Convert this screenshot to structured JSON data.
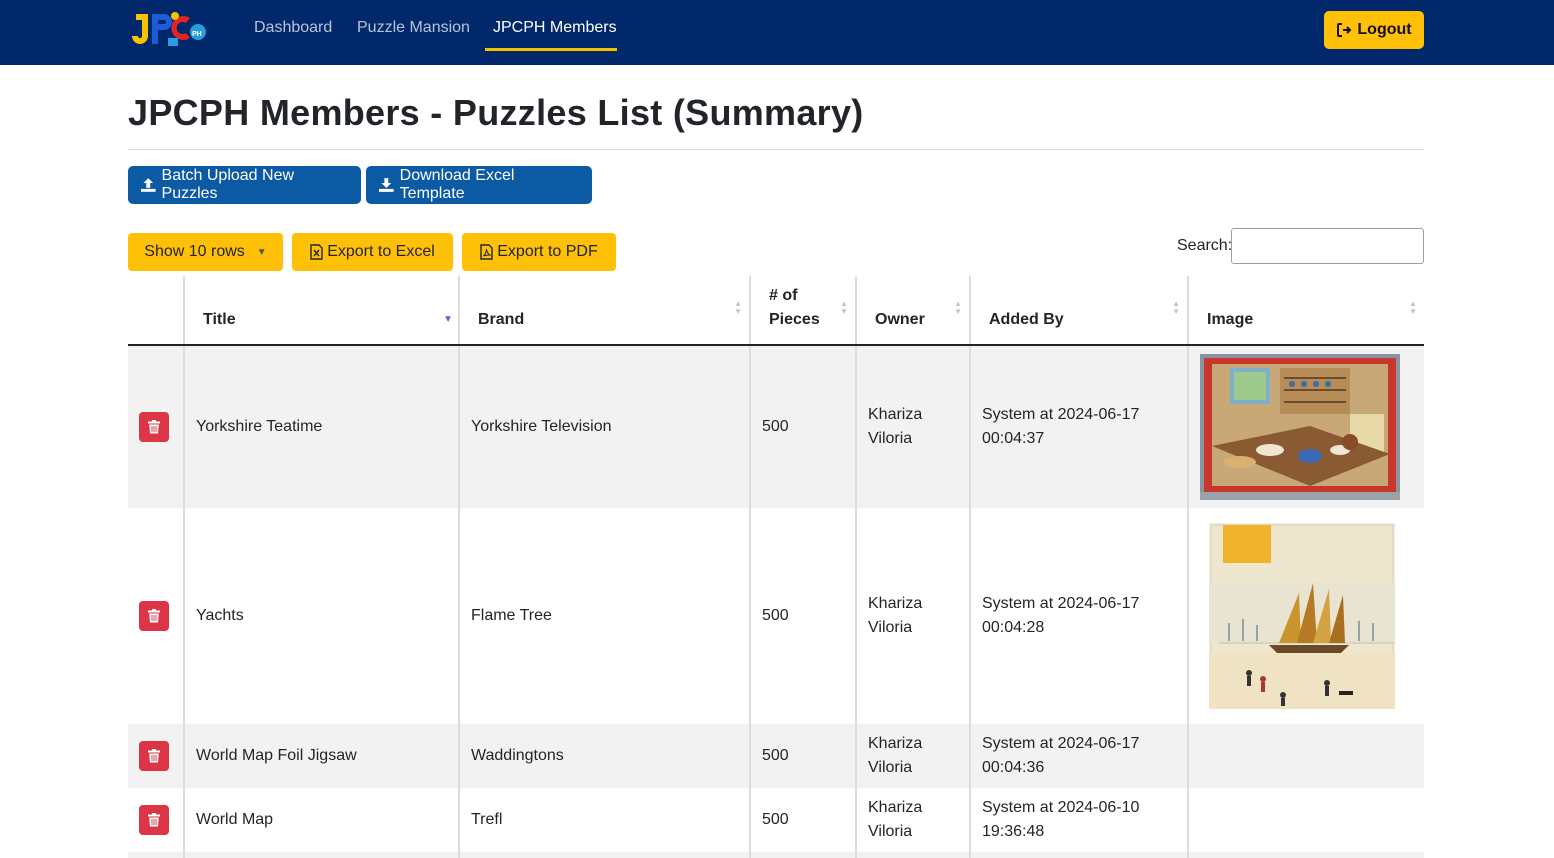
{
  "nav": {
    "links": [
      "Dashboard",
      "Puzzle Mansion",
      "JPCPH Members"
    ],
    "active": "JPCPH Members",
    "logout_label": "Logout",
    "logo_text": "JPC PH"
  },
  "page": {
    "title": "JPCPH Members - Puzzles List (Summary)"
  },
  "actions": {
    "batch_upload_label": "Batch Upload New Puzzles",
    "download_template_label": "Download Excel Template",
    "show_rows_label": "Show 10 rows",
    "export_excel_label": "Export to Excel",
    "export_pdf_label": "Export to PDF"
  },
  "search": {
    "label": "Search:",
    "value": ""
  },
  "table": {
    "headers": {
      "title": "Title",
      "brand": "Brand",
      "pieces_line1": "# of",
      "pieces_line2": "Pieces",
      "owner": "Owner",
      "added_by": "Added By",
      "image": "Image"
    },
    "rows": [
      {
        "title": "Yorkshire Teatime",
        "brand": "Yorkshire Television",
        "pieces": "500",
        "owner_first": "Khariza",
        "owner_last": "Viloria",
        "added_line1": "System at 2024-06-17",
        "added_line2": "00:04:37",
        "image": "kitchen-teatime-photo"
      },
      {
        "title": "Yachts",
        "brand": "Flame Tree",
        "pieces": "500",
        "owner_first": "Khariza",
        "owner_last": "Viloria",
        "added_line1": "System at 2024-06-17",
        "added_line2": "00:04:28",
        "image": "yachts-painting-photo"
      },
      {
        "title": "World Map Foil Jigsaw",
        "brand": "Waddingtons",
        "pieces": "500",
        "owner_first": "Khariza",
        "owner_last": "Viloria",
        "added_line1": "System at 2024-06-17",
        "added_line2": "00:04:36",
        "image": ""
      },
      {
        "title": "World Map",
        "brand": "Trefl",
        "pieces": "500",
        "owner_first": "Khariza",
        "owner_last": "Viloria",
        "added_line1": "System at 2024-06-10",
        "added_line2": "19:36:48",
        "image": ""
      }
    ]
  },
  "colors": {
    "navbar": "#00286a",
    "accent_yellow": "#ffc107",
    "primary_blue": "#0b5aa3",
    "danger_red": "#dc3545"
  }
}
